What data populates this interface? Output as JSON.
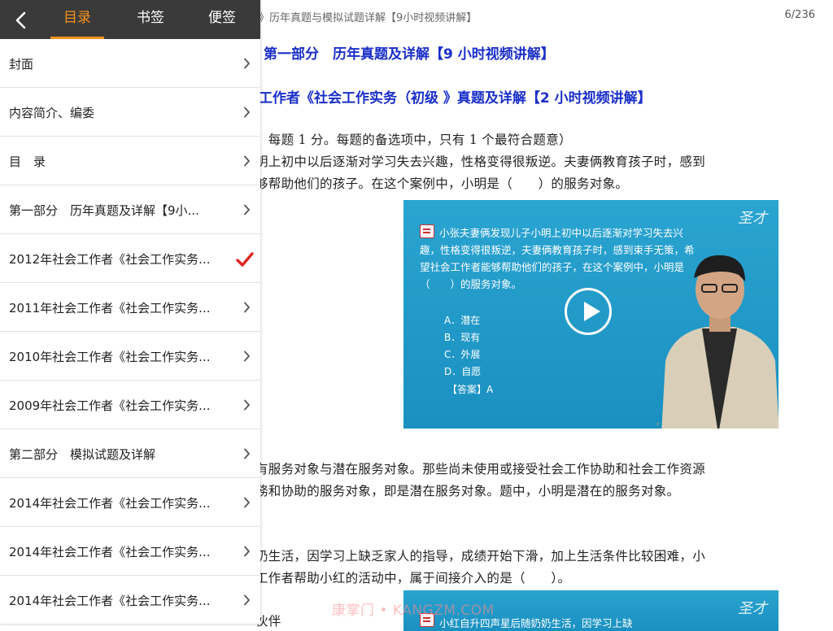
{
  "reader": {
    "breadcrumb": "》历年真题与模拟试题详解【9小时视频讲解】",
    "page_indicator": "6/236",
    "heading1": "第一部分　历年真题及详解【9 小时视频讲解】",
    "heading2": "工作者《社会工作实务（初级 》真题及详解【2 小时视频讲解】",
    "paragraphs": [
      "，每题 1 分。每题的备选项中，只有 1 个最符合题意）",
      "明上初中以后逐渐对学习失去兴趣，性格变得很叛逆。夫妻俩教育孩子时，感到",
      "够帮助他们的孩子。在这个案例中，小明是（　　）的服务对象。",
      "有服务对象与潜在服务对象。那些尚未使用或接受社会工作协助和社会工作资源",
      "務和协助的服务对象，即是潜在服务对象。题中，小明是潜在的服务对象。",
      "奶生活，因学习上缺乏家人的指导，成绩开始下滑，加上生活条件比较困难，小",
      "工作者帮助小红的活动中，属于间接介入的是（　　）。",
      "伙伴"
    ],
    "video": {
      "logo": "圣才",
      "question": "小张夫妻俩发现儿子小明上初中以后逐渐对学习失去兴趣，性格变得很叛逆，夫妻俩教育孩子时，感到束手无策，希望社会工作者能够帮助他们的孩子，在这个案例中，小明是（　　）的服务对象。",
      "options": [
        "A．潜在",
        "B．现有",
        "C．外展",
        "D．自愿"
      ],
      "answer": "【答案】A"
    },
    "video2": {
      "logo": "圣才",
      "snippet": "小红自升四声星后随奶奶生活，因学习上缺"
    },
    "watermark": "康掌门 • KANGZM.COM"
  },
  "drawer": {
    "tabs": [
      {
        "label": "目录",
        "active": true
      },
      {
        "label": "书签",
        "active": false
      },
      {
        "label": "便签",
        "active": false
      }
    ],
    "items": [
      {
        "label": "封面",
        "current": false
      },
      {
        "label": "内容简介、编委",
        "current": false
      },
      {
        "label": "目　录",
        "current": false
      },
      {
        "label": "第一部分　历年真题及详解【9小...",
        "current": false
      },
      {
        "label": "2012年社会工作者《社会工作实务...",
        "current": true
      },
      {
        "label": "2011年社会工作者《社会工作实务...",
        "current": false
      },
      {
        "label": "2010年社会工作者《社会工作实务...",
        "current": false
      },
      {
        "label": "2009年社会工作者《社会工作实务...",
        "current": false
      },
      {
        "label": "第二部分　模拟试题及详解",
        "current": false
      },
      {
        "label": "2014年社会工作者《社会工作实务...",
        "current": false
      },
      {
        "label": "2014年社会工作者《社会工作实务...",
        "current": false
      },
      {
        "label": "2014年社会工作者《社会工作实务...",
        "current": false
      }
    ]
  },
  "colors": {
    "accent": "#f6921e",
    "heading": "#1a2fc8",
    "header_bg": "#3a3a3a",
    "check": "#e0261e"
  }
}
